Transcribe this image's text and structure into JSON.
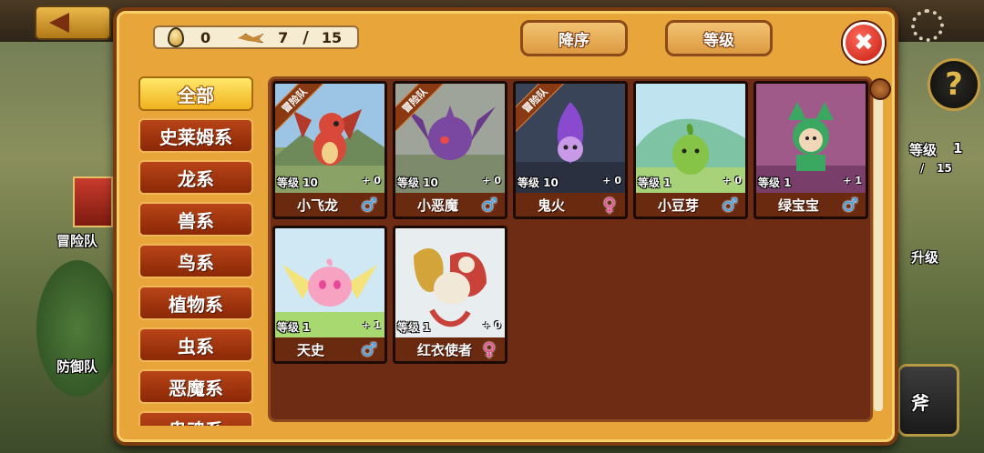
{
  "currency": {
    "eggs": "0",
    "pets_owned": "7",
    "separator": "/",
    "pets_max": "15"
  },
  "sort_buttons": [
    "降序",
    "等级"
  ],
  "close_label": "✖",
  "categories": [
    {
      "label": "全部",
      "active": true
    },
    {
      "label": "史莱姆系",
      "active": false
    },
    {
      "label": "龙系",
      "active": false
    },
    {
      "label": "兽系",
      "active": false
    },
    {
      "label": "鸟系",
      "active": false
    },
    {
      "label": "植物系",
      "active": false
    },
    {
      "label": "虫系",
      "active": false
    },
    {
      "label": "恶魔系",
      "active": false
    },
    {
      "label": "鬼魂系",
      "active": false
    }
  ],
  "pets": [
    {
      "name": "小飞龙",
      "level": "等级 10",
      "plus": "+ 0",
      "gender": "male",
      "gender_icon": "male-icon",
      "ribbon": "冒险队",
      "theme": "dragon"
    },
    {
      "name": "小恶魔",
      "level": "等级 10",
      "plus": "+ 0",
      "gender": "male",
      "gender_icon": "male-icon",
      "ribbon": "冒险队",
      "theme": "imp"
    },
    {
      "name": "鬼火",
      "level": "等级 10",
      "plus": "+ 0",
      "gender": "female",
      "gender_icon": "female-icon",
      "ribbon": "冒险队",
      "theme": "wisp"
    },
    {
      "name": "小豆芽",
      "level": "等级 1",
      "plus": "+ 0",
      "gender": "male",
      "gender_icon": "male-icon",
      "ribbon": "",
      "theme": "sprout"
    },
    {
      "name": "绿宝宝",
      "level": "等级 1",
      "plus": "+ 1",
      "gender": "male",
      "gender_icon": "male-icon",
      "ribbon": "",
      "theme": "green"
    },
    {
      "name": "天史",
      "level": "等级 1",
      "plus": "+ 1",
      "gender": "male",
      "gender_icon": "male-icon",
      "ribbon": "",
      "theme": "angel"
    },
    {
      "name": "红衣使者",
      "level": "等级 1",
      "plus": "+ 0",
      "gender": "female",
      "gender_icon": "female-icon",
      "ribbon": "",
      "theme": "phoenix"
    }
  ],
  "background": {
    "left_labels": [
      "冒险队",
      "防御队"
    ],
    "right_labels": [
      "等级",
      "1",
      "/",
      "15",
      "升级",
      "斧"
    ],
    "help_label": "?"
  },
  "colors": {
    "panel": "#e8a63a",
    "grid": "#6e2c14",
    "category": "#b84418",
    "category_active": "#f0b21e",
    "male": "#3aa0e8",
    "female": "#e8489a"
  }
}
